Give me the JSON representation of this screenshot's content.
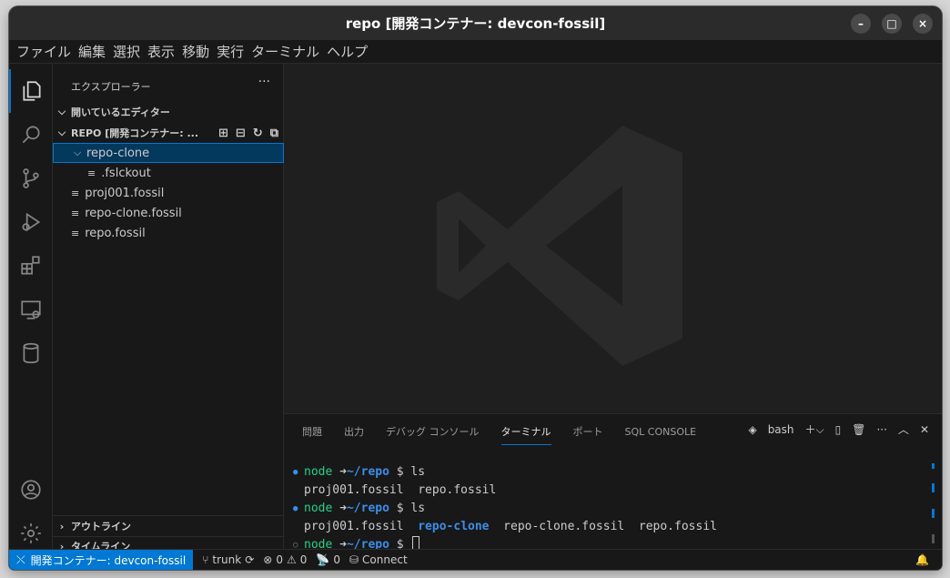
{
  "window": {
    "title": "repo [開発コンテナー: devcon-fossil]",
    "minimize": "–",
    "maximize": "□",
    "close": "×"
  },
  "menu": [
    "ファイル",
    "編集",
    "選択",
    "表示",
    "移動",
    "実行",
    "ターミナル",
    "ヘルプ"
  ],
  "sidebar": {
    "title": "エクスプローラー",
    "more": "···",
    "open_editors": "開いているエディター",
    "repo_section": "REPO [開発コンテナー: ...",
    "tree": [
      {
        "label": "repo-clone",
        "type": "folder"
      },
      {
        "label": ".fslckout",
        "type": "file"
      },
      {
        "label": "proj001.fossil",
        "type": "file"
      },
      {
        "label": "repo-clone.fossil",
        "type": "file"
      },
      {
        "label": "repo.fossil",
        "type": "file"
      }
    ],
    "outline": "アウトライン",
    "timeline": "タイムライン"
  },
  "panel": {
    "tabs": [
      "問題",
      "出力",
      "デバッグ コンソール",
      "ターミナル",
      "ポート",
      "SQL CONSOLE"
    ],
    "active_tab": "ターミナル",
    "shell": "bash",
    "terminal": {
      "prompt_user": "node",
      "arrow": "➜",
      "cwd": "~/repo",
      "dollar": "$",
      "cmd1": "ls",
      "out1": "proj001.fossil  repo.fossil",
      "cmd2": "ls",
      "out2_a": "proj001.fossil  ",
      "out2_dir": "repo-clone",
      "out2_b": "  repo-clone.fossil  repo.fossil"
    }
  },
  "status": {
    "remote": "開発コンテナー: devcon-fossil",
    "branch": "trunk",
    "errors": "0",
    "warnings": "0",
    "ports": "0",
    "connect": "Connect"
  },
  "colors": {
    "accent": "#0078d4",
    "prompt_green": "#23d18b",
    "dir_blue": "#3b8eea"
  }
}
